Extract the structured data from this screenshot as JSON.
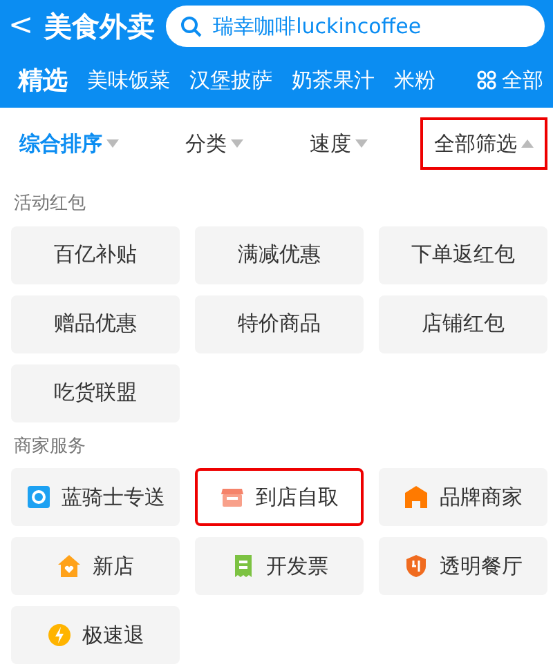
{
  "header": {
    "back": "<",
    "title": "美食外卖",
    "search": {
      "value": "瑞幸咖啡luckincoffee"
    }
  },
  "tabs": [
    {
      "label": "精选",
      "selected": true
    },
    {
      "label": "美味饭菜",
      "selected": false
    },
    {
      "label": "汉堡披萨",
      "selected": false
    },
    {
      "label": "奶茶果汁",
      "selected": false
    },
    {
      "label": "米粉",
      "selected": false
    }
  ],
  "all_tab": {
    "label": "全部"
  },
  "filters": [
    {
      "label": "综合排序",
      "selected": true,
      "expanded": false,
      "highlighted": false
    },
    {
      "label": "分类",
      "selected": false,
      "expanded": false,
      "highlighted": false
    },
    {
      "label": "速度",
      "selected": false,
      "expanded": false,
      "highlighted": false
    },
    {
      "label": "全部筛选",
      "selected": false,
      "expanded": true,
      "highlighted": true
    }
  ],
  "sections": [
    {
      "title": "活动红包",
      "options": [
        {
          "label": "百亿补贴"
        },
        {
          "label": "满减优惠"
        },
        {
          "label": "下单返红包"
        },
        {
          "label": "赠品优惠"
        },
        {
          "label": "特价商品"
        },
        {
          "label": "店铺红包"
        },
        {
          "label": "吃货联盟"
        }
      ]
    },
    {
      "title": "商家服务",
      "options": [
        {
          "label": "蓝骑士专送",
          "kind": "courier",
          "highlighted": false
        },
        {
          "label": "到店自取",
          "kind": "pickup",
          "highlighted": true
        },
        {
          "label": "品牌商家",
          "kind": "brand",
          "highlighted": false
        },
        {
          "label": "新店",
          "kind": "newstore",
          "highlighted": false
        },
        {
          "label": "开发票",
          "kind": "invoice",
          "highlighted": false
        },
        {
          "label": "透明餐厅",
          "kind": "kitchen",
          "highlighted": false
        },
        {
          "label": "极速退",
          "kind": "refund",
          "highlighted": false
        }
      ]
    }
  ]
}
